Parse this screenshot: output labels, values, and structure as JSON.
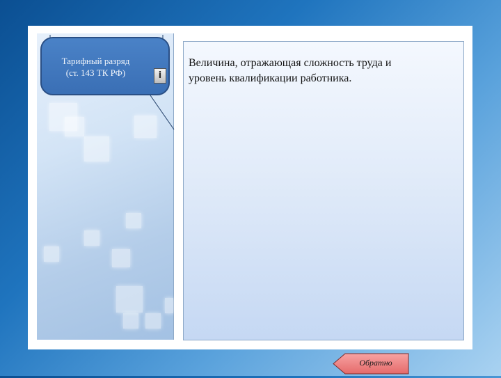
{
  "callout": {
    "line1": "Тарифный разряд",
    "line2": "(ст. 143 ТК РФ)"
  },
  "info_button": {
    "label": "i"
  },
  "definition": {
    "line1": "Величина, отражающая сложность труда и",
    "line2": "уровень квалификации работника."
  },
  "back_button": {
    "label": "Обратно"
  },
  "colors": {
    "background": "#1f74be",
    "callout_fill": "#3a6fb5",
    "panel": "#e1ebf9",
    "back_button_fill": "#f07f7f"
  }
}
